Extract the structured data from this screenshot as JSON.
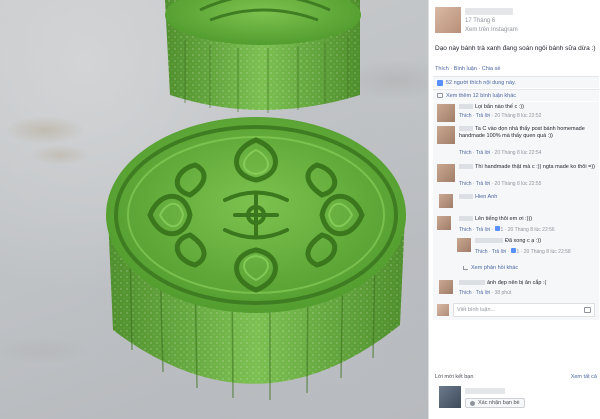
{
  "post": {
    "date": "17 Tháng 6",
    "via": "Xem trên Instagram",
    "caption": "Dạo này bánh trà xanh đang soán ngôi bánh sữa dừa :)",
    "actions": [
      "Thích",
      "Bình luận",
      "Chia sẻ"
    ],
    "likes": "52 người thích nội dung này.",
    "more_comments": "Xem thêm 12 bình luận khác"
  },
  "comments": [
    {
      "text": "Lọi bẩn nào thế c :))",
      "like": "Thích",
      "reply": "Trả lời",
      "time": "20 Tháng 8 lúc 22:52"
    },
    {
      "text": "Ta C vào dọn nhà thấy post bánh homemade handmade 100% mà thấy quen quá :))",
      "like": "Thích",
      "reply": "Trả lời",
      "time": "20 Tháng 8 lúc 22:54"
    },
    {
      "text": "Thì handmade thật mà c :)) ngta made ko thôi =))",
      "like": "Thích",
      "reply": "Trả lời",
      "time": "20 Tháng 8 lúc 22:55"
    },
    {
      "text": "Hien Anh",
      "like": "",
      "reply": "",
      "time": ""
    },
    {
      "text": "Lên tiếng thôi em ơi :)))",
      "like": "Thích",
      "reply": "Trả lời",
      "count": "1",
      "time": "20 Tháng 8 lúc 22:56"
    },
    {
      "text": "Đã xong c ạ :))",
      "like": "Thích",
      "reply": "Trả lời",
      "count": "1",
      "time": "20 Tháng 8 lúc 22:58"
    },
    {
      "text": "ảnh đẹp nên bị ăn cắp :(",
      "like": "Thích",
      "reply": "Trả lời",
      "time": "38 phút"
    }
  ],
  "replies_link": "Xem phản hồi khác",
  "write_placeholder": "Viết bình luận...",
  "friend_section": {
    "title": "Lời mời kết bạn",
    "see_all": "Xem tất cả",
    "accept": "Xác nhận bạn bè"
  },
  "colors": {
    "cake_green": "#5fa83a",
    "cake_dark": "#3f7d22",
    "link": "#4b67a1",
    "panel_bg": "#f6f7f9"
  }
}
